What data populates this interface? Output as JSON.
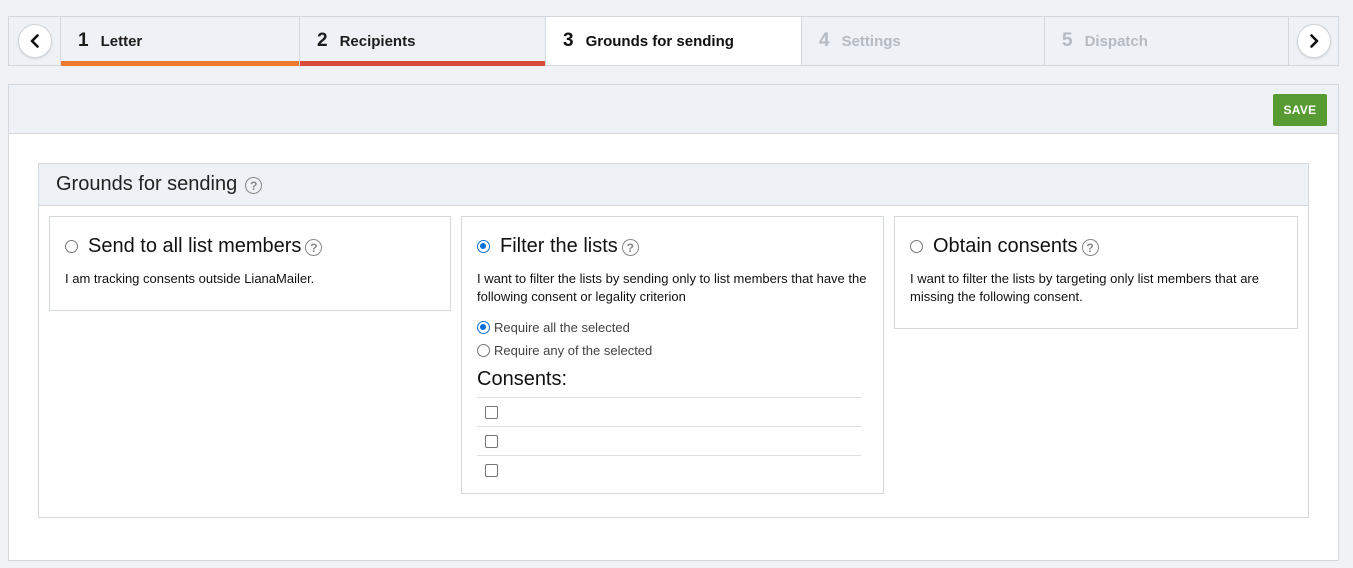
{
  "stepper": {
    "prev_icon": "chevron-left-icon",
    "next_icon": "chevron-right-icon",
    "steps": [
      {
        "num": "1",
        "label": "Letter",
        "state": "done",
        "accent": "#ec7b2f"
      },
      {
        "num": "2",
        "label": "Recipients",
        "state": "done",
        "accent": "#d84a3a"
      },
      {
        "num": "3",
        "label": "Grounds for sending",
        "state": "active",
        "accent": ""
      },
      {
        "num": "4",
        "label": "Settings",
        "state": "disabled",
        "accent": ""
      },
      {
        "num": "5",
        "label": "Dispatch",
        "state": "disabled",
        "accent": ""
      }
    ]
  },
  "toolbar": {
    "save_label": "SAVE",
    "save_color": "#579b32"
  },
  "section": {
    "title": "Grounds for sending",
    "help_icon": "question-circle-icon"
  },
  "options": [
    {
      "title": "Send to all list members",
      "description": "I am tracking consents outside LianaMailer.",
      "selected": false
    },
    {
      "title": "Filter the lists",
      "description": "I want to filter the lists by sending only to list members that have the following consent or legality criterion",
      "selected": true,
      "match_modes": [
        {
          "label": "Require all the selected",
          "selected": true
        },
        {
          "label": "Require any of the selected",
          "selected": false
        }
      ],
      "consents_title": "Consents:",
      "consents": [
        {
          "label": "",
          "checked": false
        },
        {
          "label": "",
          "checked": false
        },
        {
          "label": "",
          "checked": false
        }
      ]
    },
    {
      "title": "Obtain consents",
      "description": "I want to filter the lists by targeting only list members that are missing the following consent.",
      "selected": false
    }
  ]
}
